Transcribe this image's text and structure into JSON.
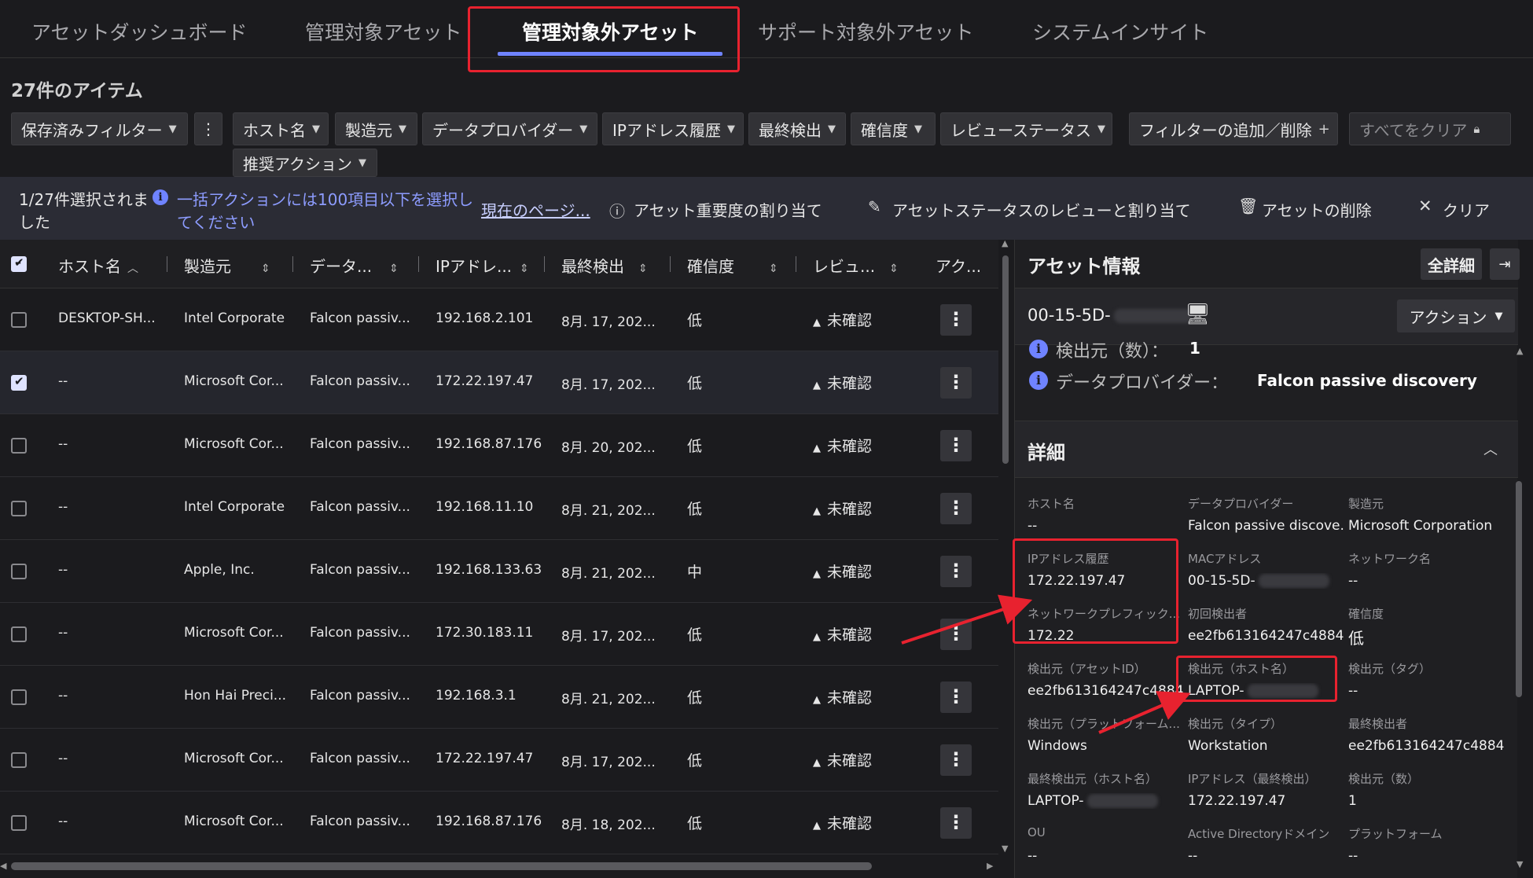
{
  "tabs": [
    "アセットダッシュボード",
    "管理対象アセット",
    "管理対象外アセット",
    "サポート対象外アセット",
    "システムインサイト"
  ],
  "item_count": "27件のアイテム",
  "filters": {
    "saved": "保存済みフィルター",
    "more": "⋮",
    "chips": [
      "ホスト名",
      "製造元",
      "データプロバイダー",
      "IPアドレス履歴",
      "最終検出",
      "確信度",
      "レビューステータス"
    ],
    "add_remove": "フィルターの追加／削除",
    "clear_all": "すべてをクリア",
    "recommended": "推奨アクション"
  },
  "actionbar": {
    "selected_line1": "1/27件選択されま",
    "selected_line2": "した",
    "info_line1": "一括アクションには100項目以下を選択し",
    "info_line2": "てください",
    "current_page": "現在のページ...",
    "assign_criticality": "アセット重要度の割り当て",
    "review_status": "アセットステータスのレビューと割り当て",
    "delete": "アセットの削除",
    "clear": "クリア"
  },
  "table": {
    "headers": [
      "ホスト名",
      "製造元",
      "データ...",
      "IPアドレ...",
      "最終検出",
      "確信度",
      "レビュ...",
      "アク..."
    ],
    "rows": [
      {
        "host": "DESKTOP-SH...",
        "maker": "Intel Corporate",
        "provider": "Falcon passiv...",
        "ip": "192.168.2.101",
        "last": "8月. 17, 202...",
        "conf": "低",
        "review": "未確認",
        "selected": false
      },
      {
        "host": "--",
        "maker": "Microsoft Cor...",
        "provider": "Falcon passiv...",
        "ip": "172.22.197.47",
        "last": "8月. 17, 202...",
        "conf": "低",
        "review": "未確認",
        "selected": true
      },
      {
        "host": "--",
        "maker": "Microsoft Cor...",
        "provider": "Falcon passiv...",
        "ip": "192.168.87.176",
        "last": "8月. 20, 202...",
        "conf": "低",
        "review": "未確認",
        "selected": false
      },
      {
        "host": "--",
        "maker": "Intel Corporate",
        "provider": "Falcon passiv...",
        "ip": "192.168.11.10",
        "last": "8月. 21, 202...",
        "conf": "低",
        "review": "未確認",
        "selected": false
      },
      {
        "host": "--",
        "maker": "Apple, Inc.",
        "provider": "Falcon passiv...",
        "ip": "192.168.133.63",
        "last": "8月. 21, 202...",
        "conf": "中",
        "review": "未確認",
        "selected": false
      },
      {
        "host": "--",
        "maker": "Microsoft Cor...",
        "provider": "Falcon passiv...",
        "ip": "172.30.183.11",
        "last": "8月. 17, 202...",
        "conf": "低",
        "review": "未確認",
        "selected": false
      },
      {
        "host": "--",
        "maker": "Hon Hai Preci...",
        "provider": "Falcon passiv...",
        "ip": "192.168.3.1",
        "last": "8月. 21, 202...",
        "conf": "低",
        "review": "未確認",
        "selected": false
      },
      {
        "host": "--",
        "maker": "Microsoft Cor...",
        "provider": "Falcon passiv...",
        "ip": "172.22.197.47",
        "last": "8月. 17, 202...",
        "conf": "低",
        "review": "未確認",
        "selected": false
      },
      {
        "host": "--",
        "maker": "Microsoft Cor...",
        "provider": "Falcon passiv...",
        "ip": "192.168.87.176",
        "last": "8月. 18, 202...",
        "conf": "低",
        "review": "未確認",
        "selected": false
      }
    ]
  },
  "panel": {
    "title": "アセット情報",
    "full_details": "全詳細",
    "asset_id": "00-15-5D-",
    "action": "アクション",
    "sources_label": "検出元（数）：",
    "sources_value": "1",
    "provider_label": "データプロバイダー：",
    "provider_value": "Falcon passive discovery",
    "details_title": "詳細",
    "fields": [
      {
        "label": "ホスト名",
        "value": "--"
      },
      {
        "label": "データプロバイダー",
        "value": "Falcon passive discove..."
      },
      {
        "label": "製造元",
        "value": "Microsoft Corporation"
      },
      {
        "label": "IPアドレス履歴",
        "value": "172.22.197.47"
      },
      {
        "label": "MACアドレス",
        "value": "00-15-5D-"
      },
      {
        "label": "ネットワーク名",
        "value": "--"
      },
      {
        "label": "ネットワークプレフィック...",
        "value": "172.22"
      },
      {
        "label": "初回検出者",
        "value": "ee2fb613164247c4884..."
      },
      {
        "label": "確信度",
        "value": "低"
      },
      {
        "label": "検出元（アセットID）",
        "value": "ee2fb613164247c4884..."
      },
      {
        "label": "検出元（ホスト名）",
        "value": "LAPTOP-"
      },
      {
        "label": "検出元（タグ）",
        "value": "--"
      },
      {
        "label": "検出元（プラットフォーム...",
        "value": "Windows"
      },
      {
        "label": "検出元（タイプ）",
        "value": "Workstation"
      },
      {
        "label": "最終検出者",
        "value": "ee2fb613164247c4884..."
      },
      {
        "label": "最終検出元（ホスト名）",
        "value": "LAPTOP-"
      },
      {
        "label": "IPアドレス（最終検出）",
        "value": "172.22.197.47"
      },
      {
        "label": "検出元（数）",
        "value": "1"
      },
      {
        "label": "OU",
        "value": "--"
      },
      {
        "label": "Active Directoryドメイン",
        "value": "--"
      },
      {
        "label": "プラットフォーム",
        "value": "--"
      }
    ]
  },
  "colors": {
    "accent": "#6f83ff",
    "highlight": "#e8222f",
    "background": "#1b1b1e"
  }
}
